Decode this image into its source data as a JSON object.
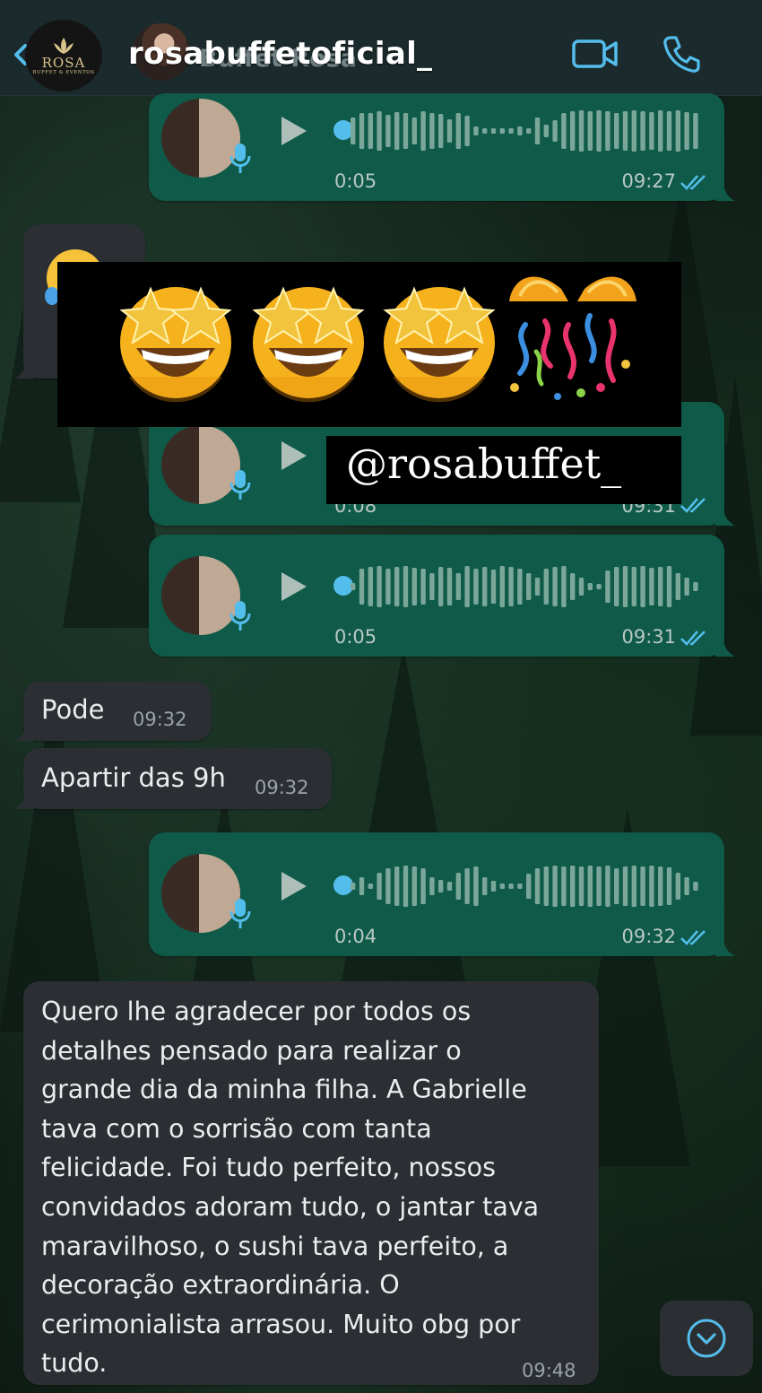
{
  "header": {
    "account_name": "rosabuffetoficial_",
    "ghost_name": "Buffet Rosa",
    "logo_brand": "ROSA",
    "logo_sub": "BUFFET & EVENTOS"
  },
  "voice_messages": [
    {
      "duration": "0:05",
      "time": "09:27",
      "progress": 0.0
    },
    {
      "duration": "0:08",
      "time": "09:31",
      "progress": 0.0
    },
    {
      "duration": "0:05",
      "time": "09:31",
      "progress": 0.0
    },
    {
      "duration": "0:04",
      "time": "09:32",
      "progress": 0.0
    }
  ],
  "incoming": [
    {
      "text": "Pode",
      "time": "09:32"
    },
    {
      "text": "Apartir das 9h",
      "time": "09:32"
    }
  ],
  "long_message": {
    "text": "Quero lhe agradecer por todos os\ndetalhes pensado para realizar o\ngrande dia da minha filha. A Gabrielle\ntava com o sorrisão com tanta\nfelicidade. Foi tudo perfeito, nossos\nconvidados adoram tudo, o jantar tava\nmaravilhoso, o sushi tava perfeito, a\ndecoração extraordinária. O\ncerimonialista arrasou. Muito obg por\ntudo.",
    "time": "09:48"
  },
  "story_overlay": {
    "tag": "@rosabuffet_",
    "emojis": [
      "star-struck-icon",
      "star-struck-icon",
      "star-struck-icon",
      "party-popper-icon"
    ]
  },
  "colors": {
    "outgoing_bubble": "#0f5a48",
    "incoming_bubble": "#2b2f33",
    "accent_blue": "#53bdeb",
    "header": "#1b2a2c"
  }
}
